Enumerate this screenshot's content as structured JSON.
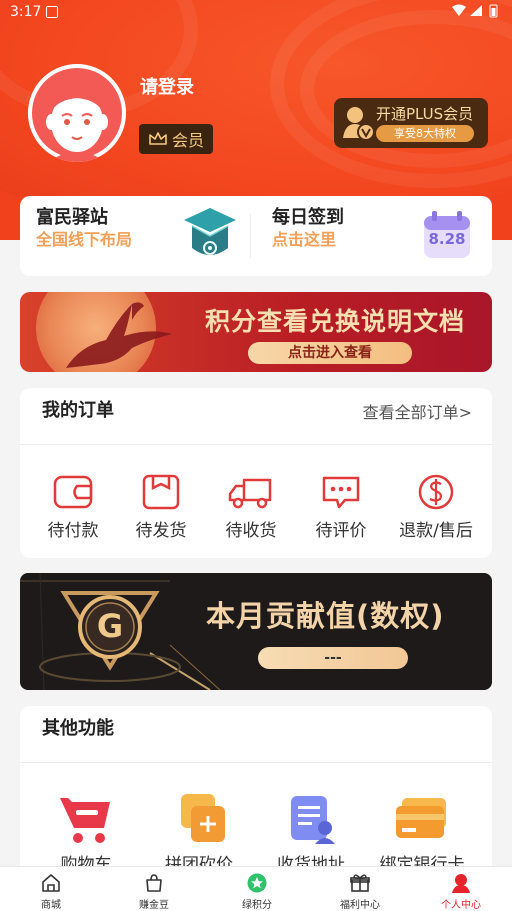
{
  "status_bar": {
    "time": "3:17"
  },
  "profile": {
    "login_text": "请登录",
    "member_label": "会员"
  },
  "plus": {
    "title": "开通PLUS会员",
    "subtitle": "享受8大特权"
  },
  "station": {
    "title": "富民驿站",
    "subtitle": "全国线下布局"
  },
  "checkin": {
    "title": "每日签到",
    "subtitle": "点击这里",
    "date": "8.28"
  },
  "banner_points": {
    "title": "积分查看兑换说明文档",
    "button": "点击进入查看"
  },
  "orders": {
    "title": "我的订单",
    "view_all": "查看全部订单>",
    "items": [
      {
        "label": "待付款",
        "icon": "wallet-icon"
      },
      {
        "label": "待发货",
        "icon": "box-icon"
      },
      {
        "label": "待收货",
        "icon": "truck-icon"
      },
      {
        "label": "待评价",
        "icon": "comment-icon"
      },
      {
        "label": "退款/售后",
        "icon": "refund-icon"
      }
    ]
  },
  "banner_contribution": {
    "logo": "G",
    "title": "本月贡献值(数权)",
    "value": "---"
  },
  "others": {
    "title": "其他功能",
    "items": [
      {
        "label": "购物车",
        "icon": "cart-icon"
      },
      {
        "label": "拼团砍价",
        "icon": "group-buy-icon"
      },
      {
        "label": "收货地址",
        "icon": "address-icon"
      },
      {
        "label": "绑定银行卡",
        "icon": "bank-card-icon"
      }
    ]
  },
  "tabbar": {
    "items": [
      {
        "label": "商城",
        "icon": "home-icon"
      },
      {
        "label": "赚金豆",
        "icon": "bag-icon"
      },
      {
        "label": "绿积分",
        "icon": "star-icon"
      },
      {
        "label": "福利中心",
        "icon": "gift-icon"
      },
      {
        "label": "个人中心",
        "icon": "person-icon"
      }
    ],
    "active_index": 4
  },
  "colors": {
    "brand": "#f0411c",
    "accent_orange": "#f0a058",
    "active_red": "#e5232b"
  }
}
